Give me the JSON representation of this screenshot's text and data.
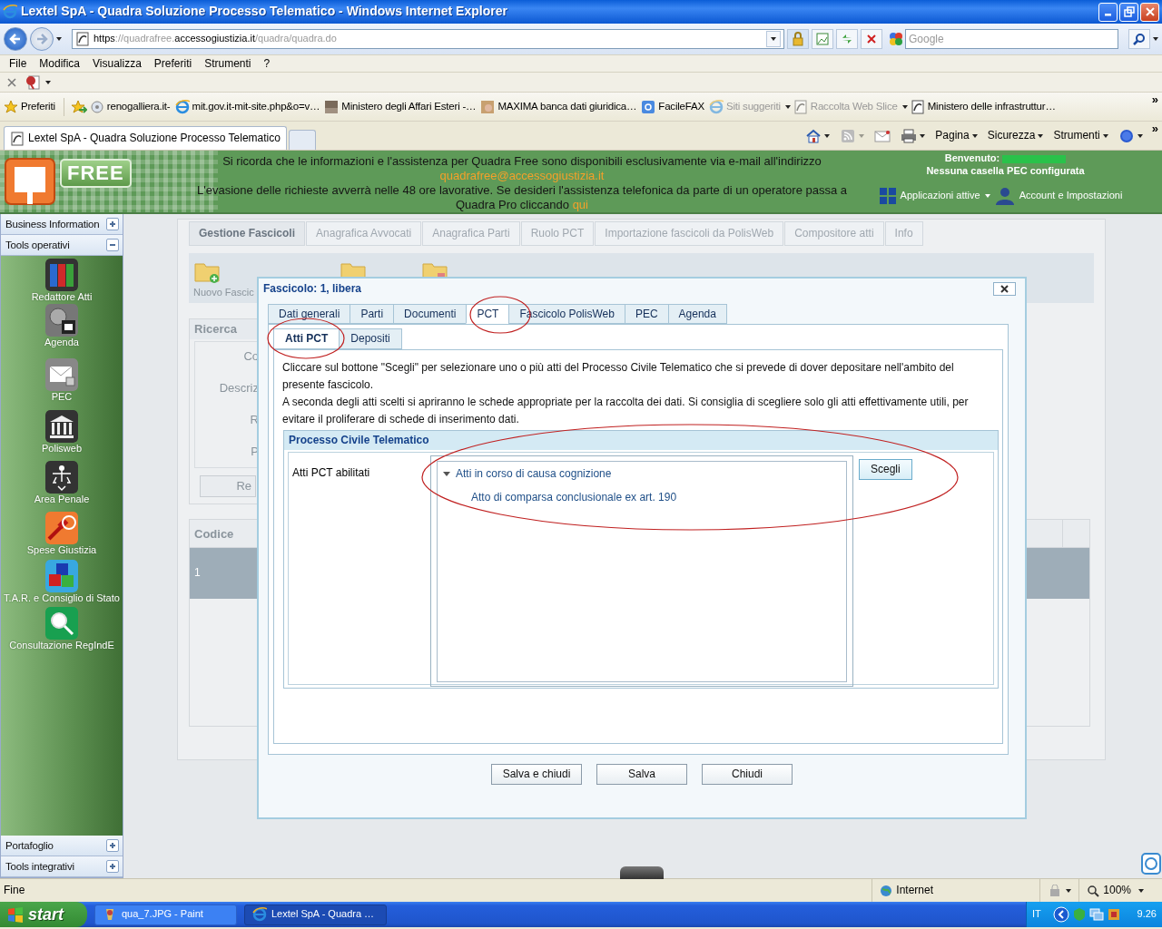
{
  "window": {
    "title": "Lextel SpA - Quadra Soluzione Processo Telematico - Windows Internet Explorer"
  },
  "address_bar": {
    "scheme": "https",
    "host_prefix": "://quadrafree.",
    "host_main": "accessogiustizia.it",
    "path": "/quadra/quadra.do"
  },
  "search": {
    "placeholder": "Google"
  },
  "menu": [
    "File",
    "Modifica",
    "Visualizza",
    "Preferiti",
    "Strumenti",
    "?"
  ],
  "favorites_bar": {
    "label": "Preferiti",
    "overflow": "»",
    "links": [
      {
        "label": "renogalliera.it-",
        "dimmed": false,
        "dropdown": false
      },
      {
        "label": "mit.gov.it-mit-site.php&o=v…",
        "dimmed": false,
        "dropdown": false
      },
      {
        "label": "Ministero degli Affari Esteri -…",
        "dimmed": false,
        "dropdown": false
      },
      {
        "label": "MAXIMA banca dati giuridica…",
        "dimmed": false,
        "dropdown": false
      },
      {
        "label": "FacileFAX",
        "dimmed": false,
        "dropdown": false
      },
      {
        "label": "Siti suggeriti",
        "dimmed": true,
        "dropdown": true
      },
      {
        "label": "Raccolta Web Slice",
        "dimmed": true,
        "dropdown": true
      },
      {
        "label": "Ministero delle infrastruttur…",
        "dimmed": false,
        "dropdown": false
      }
    ]
  },
  "browser_tabs": [
    {
      "label": "Lextel SpA - Quadra Soluzione Processo Telematico",
      "selected": true
    }
  ],
  "command_bar": {
    "menus": [
      "Pagina",
      "Sicurezza",
      "Strumenti"
    ],
    "overflow": "»"
  },
  "header": {
    "logo": "FREE",
    "notice_1": "Si ricorda che le informazioni e l'assistenza per Quadra Free sono disponibili esclusivamente via e-mail all'indirizzo",
    "email": "quadrafree@accessogiustizia.it",
    "notice_2": "L'evasione delle richieste avverrà nelle 48 ore lavorative. Se desideri l'assistenza telefonica da parte di un operatore passa a Quadra Pro cliccando",
    "link": "qui",
    "welcome": "Benvenuto:",
    "pec": "Nessuna casella PEC configurata",
    "apps": "Applicazioni attive",
    "account": "Account e Impostazioni"
  },
  "sidebar": {
    "sections": [
      {
        "label": "Business Information",
        "expanded": false
      },
      {
        "label": "Tools operativi",
        "expanded": true,
        "tools": [
          "Redattore Atti",
          "Agenda",
          "PEC",
          "Polisweb",
          "Area Penale",
          "Spese Giustizia",
          "T.A.R. e Consiglio di Stato",
          "Consultazione RegIndE"
        ]
      },
      {
        "label": "Portafoglio",
        "expanded": false
      },
      {
        "label": "Tools integrativi",
        "expanded": false
      }
    ]
  },
  "main_tabs": [
    {
      "label": "Gestione Fascicoli",
      "selected": true
    },
    {
      "label": "Anagrafica Avvocati",
      "selected": false
    },
    {
      "label": "Anagrafica Parti",
      "selected": false
    },
    {
      "label": "Ruolo PCT",
      "selected": false
    },
    {
      "label": "Importazione fascicoli da PolisWeb",
      "selected": false
    },
    {
      "label": "Compositore atti",
      "selected": false
    },
    {
      "label": "Info",
      "selected": false
    }
  ],
  "toolbar": {
    "new_label": "Nuovo Fascic"
  },
  "search_panel": {
    "title": "Ricerca",
    "labels": [
      "Co",
      "Descriz",
      "R",
      "P"
    ],
    "button": "Re"
  },
  "table": {
    "columns": [
      "Codice"
    ],
    "rows": [
      {
        "cells": [
          "1"
        ],
        "selected": true
      }
    ]
  },
  "dialog": {
    "title": "Fascicolo: 1, libera",
    "tabs": [
      {
        "label": "Dati generali",
        "selected": false
      },
      {
        "label": "Parti",
        "selected": false
      },
      {
        "label": "Documenti",
        "selected": false
      },
      {
        "label": "PCT",
        "selected": true
      },
      {
        "label": "Fascicolo PolisWeb",
        "selected": false
      },
      {
        "label": "PEC",
        "selected": false
      },
      {
        "label": "Agenda",
        "selected": false
      }
    ],
    "subtabs": [
      {
        "label": "Atti PCT",
        "selected": true
      },
      {
        "label": "Depositi",
        "selected": false
      }
    ],
    "paragraphs": [
      "Cliccare sul bottone \"Scegli\" per selezionare uno o più atti del Processo Civile Telematico che si prevede di dover depositare nell'ambito del presente fascicolo.",
      "A seconda degli atti scelti si apriranno le schede appropriate per la raccolta dei dati. Si consiglia di scegliere solo gli atti effettivamente utili, per evitare il proliferare di schede di inserimento dati."
    ],
    "fieldset": "Processo Civile Telematico",
    "field_label": "Atti PCT abilitati",
    "tree": [
      {
        "label": "Atti in corso di causa cognizione",
        "expanded": true,
        "children": [
          {
            "label": "Atto di comparsa conclusionale ex art. 190"
          }
        ]
      }
    ],
    "choose_button": "Scegli",
    "buttons": [
      "Salva e chiudi",
      "Salva",
      "Chiudi"
    ],
    "markup": [
      {
        "kind": "ellipse"
      },
      {
        "kind": "ellipse"
      },
      {
        "kind": "ellipse"
      }
    ]
  },
  "status_bar": {
    "text": "Fine",
    "zone": "Internet",
    "zoom": "100%"
  },
  "taskbar": {
    "start": "start",
    "tasks": [
      {
        "label": "qua_7.JPG - Paint",
        "selected": false
      },
      {
        "label": "Lextel SpA - Quadra …",
        "selected": true
      }
    ],
    "language": "IT",
    "clock": "9.26"
  }
}
